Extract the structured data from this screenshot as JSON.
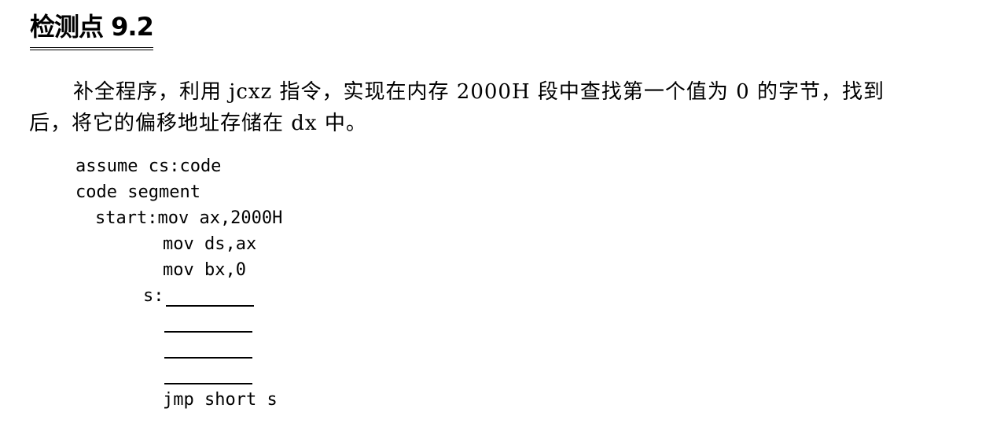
{
  "title": "检测点 9.2",
  "paragraph": "补全程序，利用 jcxz 指令，实现在内存 2000H 段中查找第一个值为 0 的字节，找到后，将它的偏移地址存储在 dx 中。",
  "code": {
    "line1": "assume cs:code",
    "line2": "code segment",
    "line3": "start:mov ax,2000H",
    "line4": "mov ds,ax",
    "line5": "mov bx,0",
    "label_s": "s:",
    "line_last": "jmp short s"
  }
}
